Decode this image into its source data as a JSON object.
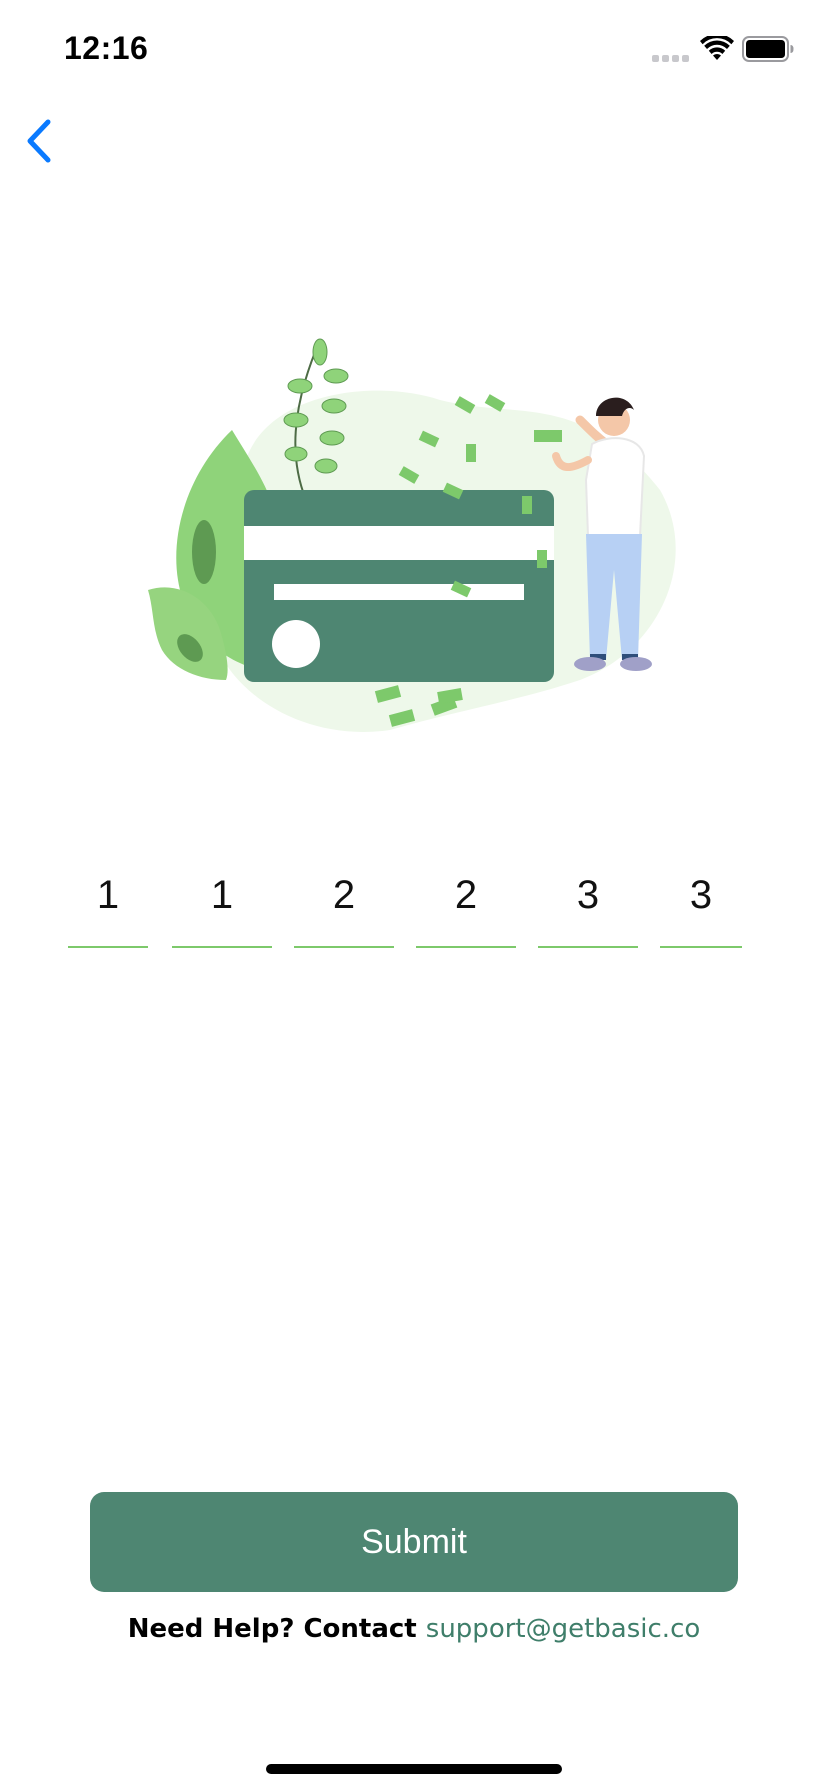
{
  "status_bar": {
    "time": "12:16",
    "icons": [
      "signal-icon",
      "wifi-icon",
      "battery-icon"
    ]
  },
  "nav": {
    "back_icon": "chevron-left-icon",
    "accent_color": "#0a7aff"
  },
  "illustration": {
    "name": "credit-card-with-person-illustration",
    "card_color": "#4e8672",
    "leaf_color": "#88cc6d"
  },
  "otp": {
    "digits": [
      "1",
      "1",
      "2",
      "2",
      "3",
      "3"
    ],
    "underline_color": "#7dc96b"
  },
  "submit": {
    "label": "Submit",
    "color": "#4e8672"
  },
  "help": {
    "prefix": "Need Help? Contact ",
    "email": "support@getbasic.co",
    "email_color": "#3f7e6a"
  }
}
